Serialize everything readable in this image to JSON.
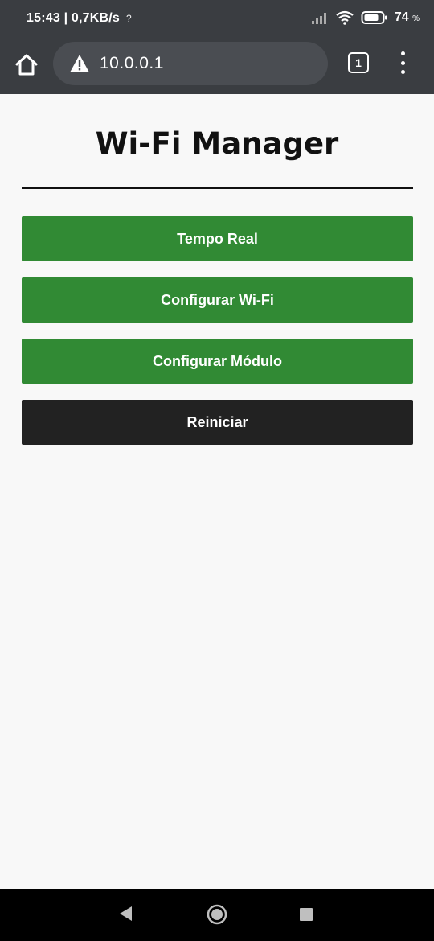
{
  "status_bar": {
    "time_speed": "15:43 | 0,7KB/s",
    "unknown_symbol": "?",
    "battery_level": "74",
    "battery_unit": "%"
  },
  "browser": {
    "url": "10.0.0.1",
    "tab_count": "1"
  },
  "page": {
    "title": "Wi-Fi Manager",
    "buttons": [
      {
        "label": "Tempo Real"
      },
      {
        "label": "Configurar Wi-Fi"
      },
      {
        "label": "Configurar Módulo"
      },
      {
        "label": "Reiniciar"
      }
    ]
  },
  "colors": {
    "primary_button": "#318a34",
    "secondary_button": "#222222",
    "chrome": "#3a3d41"
  },
  "icons": [
    "home-icon",
    "warning-icon",
    "tabs-icon",
    "menu-icon",
    "wifi-icon",
    "signal-icon",
    "battery-icon",
    "back-icon",
    "circle-home-icon",
    "recents-icon"
  ]
}
